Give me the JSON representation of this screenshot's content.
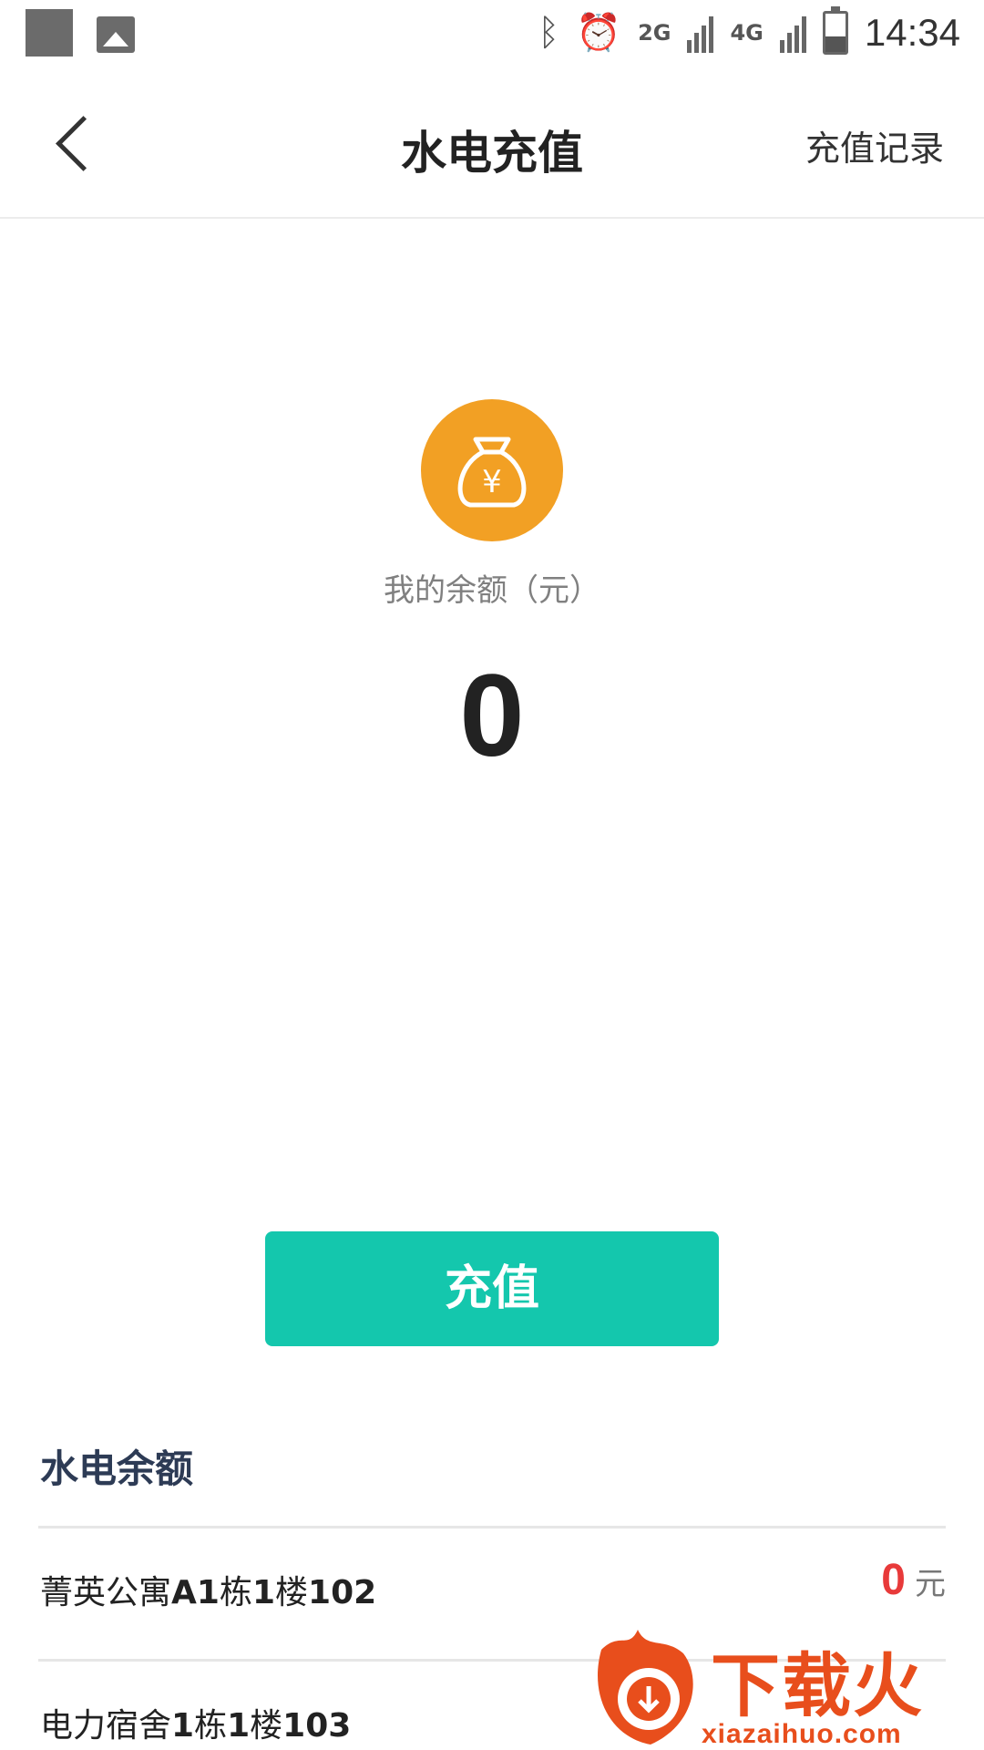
{
  "status_bar": {
    "network_2g": "2G",
    "network_4g": "4G",
    "time": "14:34",
    "battery_level_percent": 40
  },
  "nav": {
    "title": "水电充值",
    "right_link": "充值记录"
  },
  "balance": {
    "label": "我的余额（元）",
    "amount": "0",
    "icon": "money-bag-icon"
  },
  "recharge_button": "充值",
  "utilities": {
    "title": "水电余额",
    "rows": [
      {
        "name_prefix": "菁英公寓",
        "name_bold": "A1",
        "name_mid": "栋",
        "name_bold2": "1",
        "name_mid2": "楼",
        "name_bold3": "102",
        "value": "0",
        "unit": "元"
      },
      {
        "name_prefix": "电力宿舍",
        "name_bold": "1",
        "name_mid": "栋",
        "name_bold2": "1",
        "name_mid2": "楼",
        "name_bold3": "103"
      }
    ]
  },
  "watermark": {
    "text": "下载火",
    "url": "xiazaihuo.com"
  },
  "colors": {
    "accent": "#14c7ad",
    "bag": "#f2a024",
    "value_red": "#e83a3a",
    "watermark": "#e84e1c"
  }
}
